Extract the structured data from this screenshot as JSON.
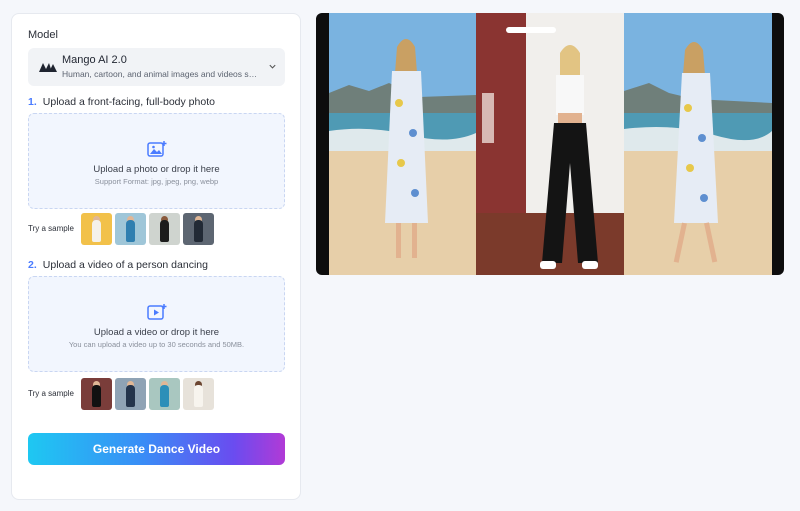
{
  "model": {
    "label": "Model",
    "name": "Mango AI 2.0",
    "description": "Human, cartoon, and animal images and videos sup..."
  },
  "step1": {
    "number": "1.",
    "title": "Upload a front-facing, full-body photo",
    "drop_title": "Upload a photo or drop it here",
    "drop_sub": "Support Format: jpg, jpeg, png, webp",
    "sample_label": "Try a sample"
  },
  "step2": {
    "number": "2.",
    "title": "Upload a video of a person dancing",
    "drop_title": "Upload a video or drop it here",
    "drop_sub": "You can upload a video up to 30 seconds and 50MB.",
    "sample_label": "Try a sample"
  },
  "generate_label": "Generate Dance Video",
  "colors": {
    "accent": "#4a7bff",
    "gradient_start": "#1ec8f2",
    "gradient_end": "#b13ad6"
  }
}
